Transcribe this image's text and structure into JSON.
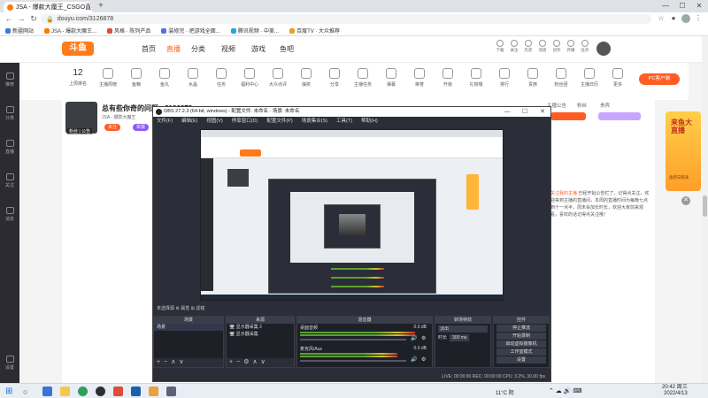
{
  "browser": {
    "tabs": [
      {
        "title": "JSA - 爆款大魔王_CSGO直播",
        "active": true
      }
    ],
    "address": "douyu.com/3126878",
    "bookmarks": [
      "新疆网站",
      "JSA - 爆款大魔王...",
      "风格 · 陈列产品",
      "装修完 · 把游戏全面...",
      "腾讯视频 · 中美...",
      "百度TV · 大众推荐"
    ]
  },
  "site": {
    "logo": "斗鱼",
    "nav": [
      "首页",
      "直播",
      "分类",
      "视频",
      "游戏",
      "鱼吧"
    ],
    "nav_active": "直播",
    "header_icons": [
      "下载",
      "关注",
      "历史",
      "消息",
      "创作",
      "开播",
      "任务"
    ],
    "categories": [
      {
        "label": "上周排名",
        "num": "12"
      },
      {
        "label": "主播周榜"
      },
      {
        "label": "鱼粮"
      },
      {
        "label": "鱼丸"
      },
      {
        "label": "水晶"
      },
      {
        "label": "任务"
      },
      {
        "label": "福利中心"
      },
      {
        "label": "大众点评"
      },
      {
        "label": "抽奖"
      },
      {
        "label": "分享"
      },
      {
        "label": "主播任务"
      },
      {
        "label": "弹幕"
      },
      {
        "label": "荣誉"
      },
      {
        "label": "升级"
      },
      {
        "label": "礼物墙"
      },
      {
        "label": "排行"
      },
      {
        "label": "贵族"
      },
      {
        "label": "粉丝团"
      },
      {
        "label": "主播日历"
      },
      {
        "label": "更多"
      }
    ],
    "pc_client_label": "PC客户端",
    "room": {
      "title": "总有些你奇的问题 - 3126878",
      "subtitle": "JSA - 爆款大魔王",
      "fans": "粉丝 | 公告",
      "pill1": "关注",
      "pill2": "举报"
    },
    "side": {
      "tabs": [
        "主播公告",
        "粉丝",
        "贵宾"
      ],
      "text_highlight": "关注我的主播",
      "text": "已经开始公告栏了，记得点关注，欢迎来到主播的直播间，本周的直播时间为每晚七点到十一点半，周末会加长时长，欢迎大家前来观看，喜欢的话记得点关注哦！"
    },
    "rail": [
      "推荐",
      "分类",
      "直播",
      "关注",
      "消息",
      "设置"
    ],
    "promo": {
      "title": "来鱼大直播",
      "sub": "鱼吧日程表"
    }
  },
  "obs": {
    "title": "OBS 27.2.3 (64-bit, windows) - 配置文件: 未命名 - 场景: 未命名",
    "menu": [
      "文件(F)",
      "编辑(E)",
      "视图(V)",
      "停靠窗口(D)",
      "配置文件(P)",
      "场景集合(S)",
      "工具(T)",
      "帮助(H)"
    ],
    "scene_bar": "未选择源    ⚙ 属性    ⊞ 滤镜",
    "docks": {
      "scenes": {
        "title": "场景",
        "items": [
          "场景"
        ]
      },
      "sources": {
        "title": "来源",
        "items": [
          "显示器采集 2",
          "显示器采集"
        ]
      },
      "mixer": {
        "title": "混音器",
        "tracks": [
          {
            "name": "桌面音频",
            "db": "0.0 dB"
          },
          {
            "name": "麦克风/Aux",
            "db": "0.0 dB"
          }
        ]
      },
      "transitions": {
        "title": "转场特效",
        "fade": "淡出",
        "duration_label": "时长",
        "duration": "300 ms"
      },
      "controls": {
        "title": "控件",
        "buttons": [
          "停止推流",
          "开始录制",
          "启动虚拟摄像机",
          "工作室模式",
          "设置",
          "退出"
        ]
      }
    },
    "status": "LIVE: 00:00:00    REC: 00:00:00    CPU: 3.2%, 30.00 fps"
  },
  "taskbar": {
    "weather": "11°C 阴",
    "time": "20:42",
    "weekday": "周三",
    "date": "2022/4/13"
  }
}
